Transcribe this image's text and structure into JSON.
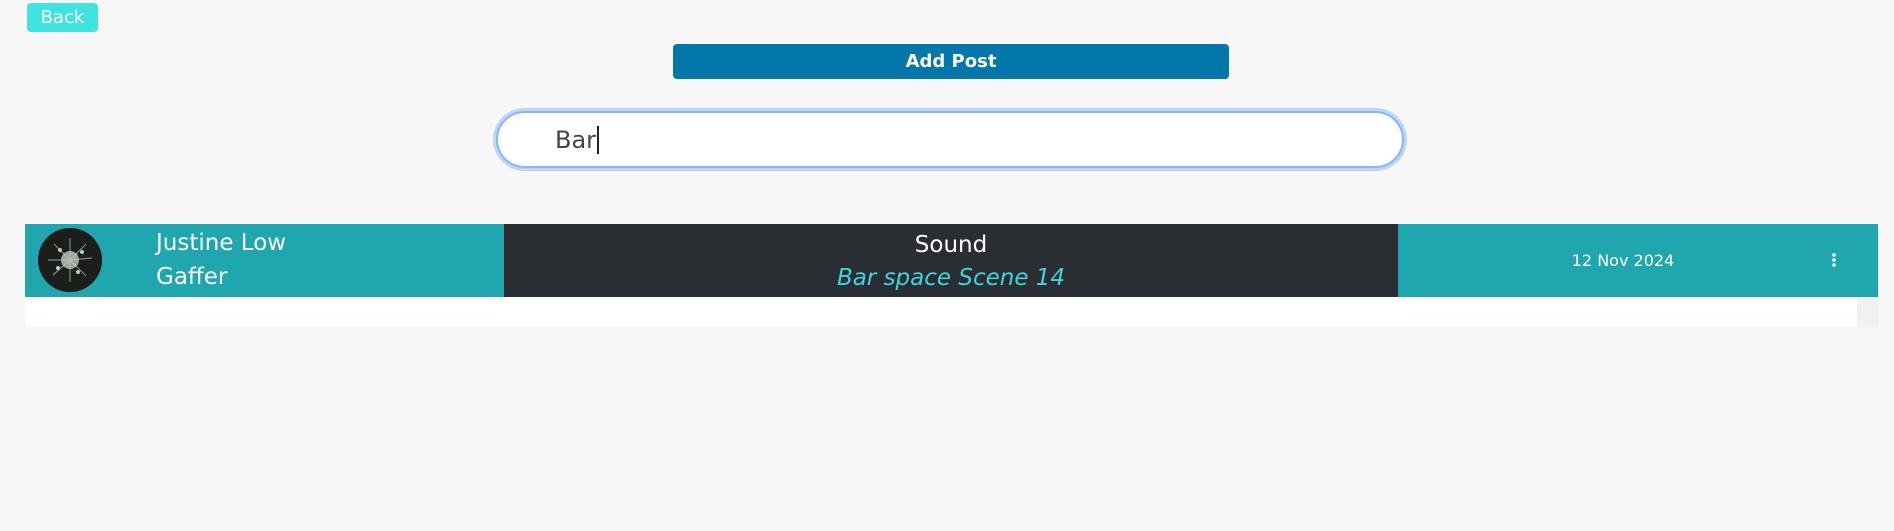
{
  "header": {
    "back_label": "Back",
    "add_post_label": "Add Post"
  },
  "search": {
    "value": "Bar"
  },
  "posts": [
    {
      "user_name": "Justine Low",
      "user_role": "Gaffer",
      "category": "Sound",
      "description": "Bar space Scene 14",
      "date": "12 Nov 2024",
      "menu_icon": "vertical-dots-icon"
    }
  ],
  "colors": {
    "back_button": "#3fe3df",
    "add_post_button": "#0377aa",
    "row_accent": "#1fa6ae",
    "row_dark": "#2a2e32",
    "description_text": "#3fd3dc"
  }
}
